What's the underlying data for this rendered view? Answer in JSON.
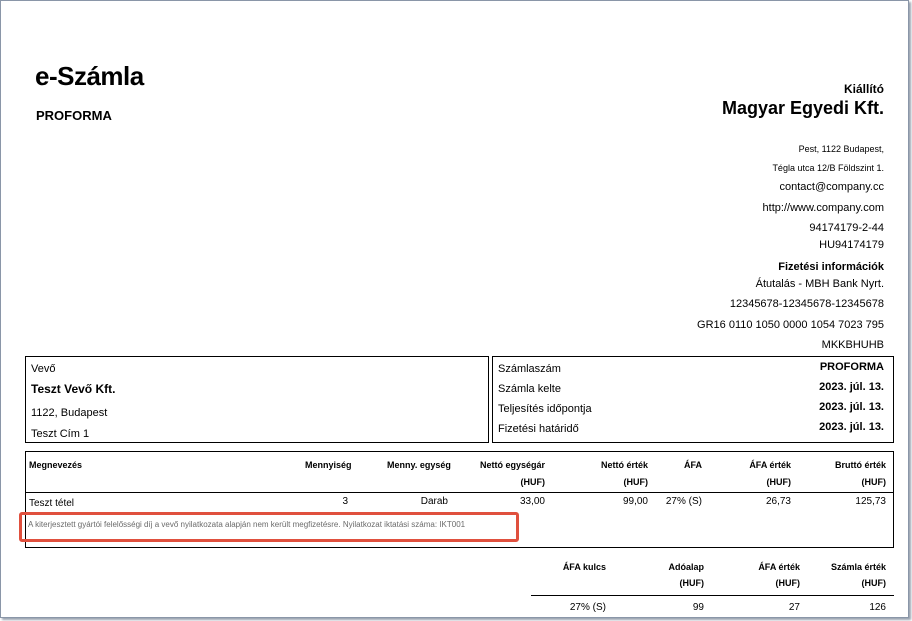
{
  "doc": {
    "title": "e-Számla",
    "subtitle": "PROFORMA"
  },
  "issuer": {
    "label": "Kiállító",
    "name": "Magyar Egyedi Kft.",
    "address1": "Pest, 1122 Budapest,",
    "address2": "Tégla utca 12/B Földszint 1.",
    "email": "contact@company.cc",
    "web": "http://www.company.com",
    "tax_id": "94174179-2-44",
    "eu_tax_id": "HU94174179",
    "payment_label": "Fizetési információk",
    "payment_method": "Átutalás - MBH Bank Nyrt.",
    "account": "12345678-12345678-12345678",
    "iban": "GR16 0110 1050 0000 1054 7023 795",
    "swift": "MKKBHUHB"
  },
  "buyer": {
    "label": "Vevő",
    "name": "Teszt Vevő Kft.",
    "city": "1122, Budapest",
    "street": "Teszt Cím 1"
  },
  "invoice_meta": [
    {
      "label": "Számlaszám",
      "value": "PROFORMA"
    },
    {
      "label": "Számla kelte",
      "value": "2023. júl. 13."
    },
    {
      "label": "Teljesítés időpontja",
      "value": "2023. júl. 13."
    },
    {
      "label": "Fizetési határidő",
      "value": "2023. júl. 13."
    }
  ],
  "items_table": {
    "headers": {
      "name": "Megnevezés",
      "qty": "Mennyiség",
      "unit": "Menny. egység",
      "unit_price": "Nettó egységár",
      "unit_price_cur": "(HUF)",
      "net": "Nettó érték",
      "net_cur": "(HUF)",
      "vat": "ÁFA",
      "vat_value": "ÁFA érték",
      "vat_value_cur": "(HUF)",
      "gross": "Bruttó érték",
      "gross_cur": "(HUF)"
    },
    "rows": [
      {
        "name": "Teszt tétel",
        "qty": "3",
        "unit": "Darab",
        "unit_price": "33,00",
        "net": "99,00",
        "vat": "27% (S)",
        "vat_value": "26,73",
        "gross": "125,73"
      }
    ],
    "note": "A kiterjesztett gyártói felelősségi díj a vevő nyilatkozata alapján nem került megfizetésre. Nyilatkozat iktatási száma: IKT001"
  },
  "summary_table": {
    "headers": {
      "vat_rate": "ÁFA kulcs",
      "base": "Adóalap",
      "base_cur": "(HUF)",
      "vat_value": "ÁFA érték",
      "vat_value_cur": "(HUF)",
      "total": "Számla érték",
      "total_cur": "(HUF)"
    },
    "rows": [
      {
        "vat_rate": "27% (S)",
        "base": "99",
        "vat_value": "27",
        "total": "126"
      }
    ]
  }
}
